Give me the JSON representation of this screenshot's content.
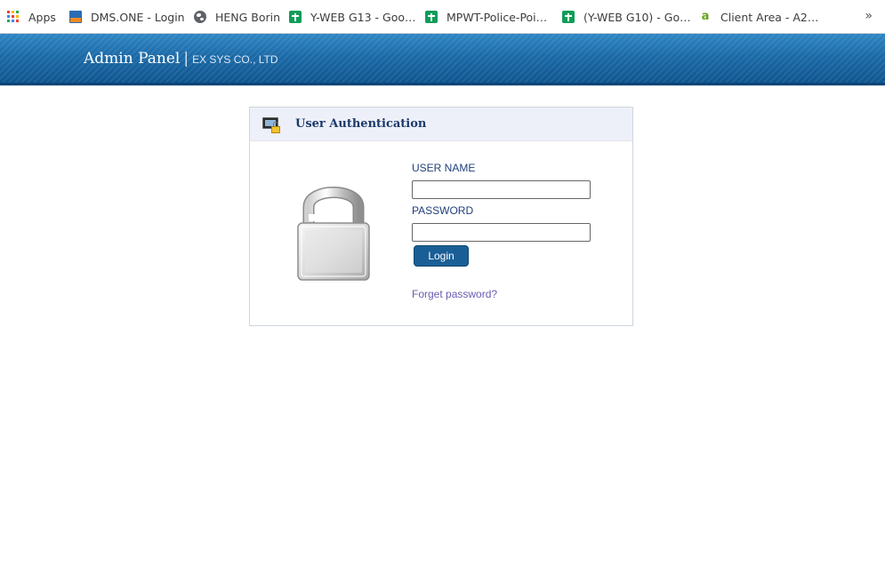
{
  "bookmarks": [
    {
      "label": "Apps",
      "icon": "apps-grid-icon"
    },
    {
      "label": "DMS.ONE - Login",
      "icon": "dms-one-icon"
    },
    {
      "label": "HENG Borin",
      "icon": "globe-icon"
    },
    {
      "label": "Y-WEB G13 - Goo…",
      "icon": "google-sheets-icon"
    },
    {
      "label": "MPWT-Police-Poi…",
      "icon": "google-sheets-icon"
    },
    {
      "label": "(Y-WEB G10) - Go…",
      "icon": "google-sheets-icon"
    },
    {
      "label": "Client Area - A2…",
      "icon": "a2-hosting-icon"
    }
  ],
  "bookmarks_overflow": "»",
  "header": {
    "title": "Admin Panel",
    "separator": "|",
    "company": "EX SYS CO., LTD"
  },
  "auth": {
    "title": "User Authentication",
    "username_label": "USER NAME",
    "username_value": "",
    "password_label": "PASSWORD",
    "password_value": "",
    "login_button": "Login",
    "forgot_link": "Forget password?"
  },
  "colors": {
    "header_blue": "#1b6aa8",
    "button_blue": "#1a5e96",
    "link_purple": "#6b5bb0",
    "label_blue": "#1f3f7a"
  }
}
